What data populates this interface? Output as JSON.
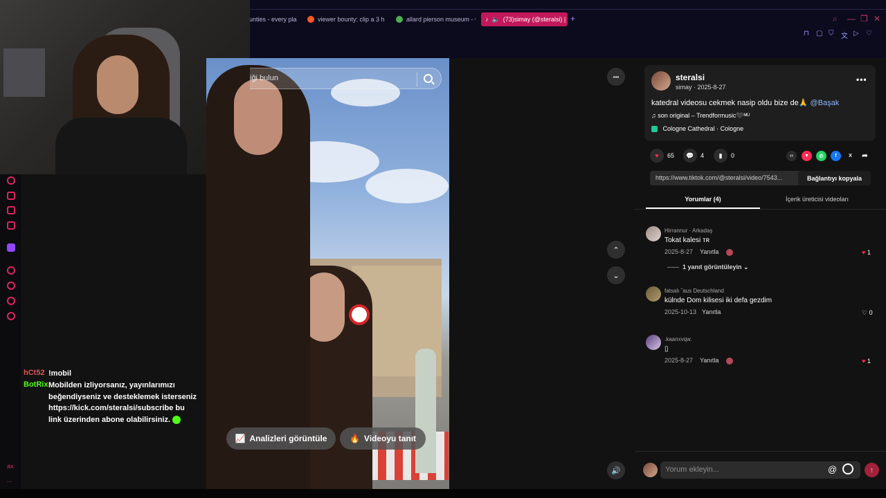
{
  "browser": {
    "tabs": [
      {
        "label": "unties - every pla",
        "fav_color": "#6c63ff"
      },
      {
        "label": "viewer bounty: clip a 3 h",
        "fav_color": "#ff5722"
      },
      {
        "label": "allard pierson museum - G",
        "fav_color": "#4caf50"
      },
      {
        "label": "(73)simay (@steralsi) |",
        "fav_color": "#ffffff"
      }
    ],
    "new_tab": "+",
    "window_controls": [
      "⌕",
      "—",
      "❐",
      "✕"
    ],
    "extension_icons": [
      "bookmark-icon",
      "window-icon",
      "shield-icon",
      "translate-icon",
      "play-icon",
      "heart-icon"
    ]
  },
  "chat": {
    "messages": [
      {
        "user": "hCt52",
        "user_color": "#e05555",
        "text": "!mobil"
      },
      {
        "user": "BotRix",
        "user_color": "#53fc18",
        "text": "Mobilden izliyorsanız, yayınlarımızı beğendiyseniz ve desteklemek isterseniz https://kick.com/steralsi/subscribe bu link üzerinden abone olabilirsiniz."
      }
    ]
  },
  "sidebar_bottom": {
    "label_1": "ax",
    "label_2": "..."
  },
  "video": {
    "search_placeholder": "iği bulun",
    "analytics_button": "Analizleri görüntüle",
    "promote_button": "Videoyu tanıt",
    "more_button": "•••",
    "up_button": "⌃",
    "down_button": "⌄",
    "volume_button": "🔊"
  },
  "post": {
    "author_name": "steralsi",
    "author_sub": "simay · 2025-8-27",
    "caption_text": "katedral videosu cekmek nasip oldu bize de🙏 ",
    "caption_mention": "@Başak",
    "music": "son original – Trendformusic🖤ᴹᵁ",
    "location": "Cologne Cathedral · Cologne",
    "likes": "65",
    "comments": "4",
    "saves": "0",
    "link_url": "https://www.tiktok.com/@steralsi/video/7543...",
    "copy_label": "Bağlantıyı kopyala",
    "share_icons": [
      "embed-icon",
      "repost-icon",
      "whatsapp-icon",
      "facebook-icon",
      "x-icon",
      "share-arrow-icon"
    ]
  },
  "tabs": {
    "comments_tab": "Yorumlar (4)",
    "creator_tab": "İçerik üreticisi videoları"
  },
  "comments": [
    {
      "user": "Hirrannur · Arkadaş",
      "text": "Tokat kalesi ᴛʀ",
      "date": "2025-8-27",
      "reply": "Yanıtla",
      "likes": "1",
      "liked": true
    },
    {
      "user": "fatsalı ˜aus Deutschland",
      "text": "külnde Dom kilisesi iki defa gezdim",
      "date": "2025-10-13",
      "reply": "Yanıtla",
      "likes": "0",
      "liked": false
    },
    {
      "user": ".kaanxvqw.",
      "text": "▯",
      "date": "2025-8-27",
      "reply": "Yanıtla",
      "likes": "1",
      "liked": true
    }
  ],
  "view_replies": "1 yanıt görüntüleyin ⌄",
  "comment_input": {
    "placeholder": "Yorum ekleyin...",
    "at": "@",
    "send": "↑"
  }
}
